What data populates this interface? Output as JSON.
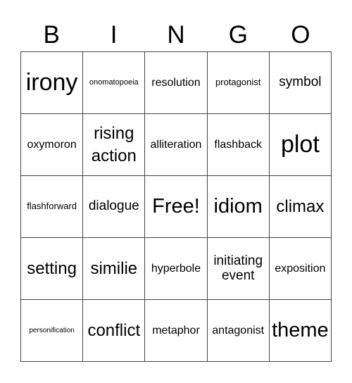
{
  "header": {
    "letters": [
      "B",
      "I",
      "N",
      "G",
      "O"
    ]
  },
  "board": {
    "rows": [
      [
        "irony",
        "onomatopoeia",
        "resolution",
        "protagonist",
        "symbol"
      ],
      [
        "oxymoron",
        "rising action",
        "alliteration",
        "flashback",
        "plot"
      ],
      [
        "flashforward",
        "dialogue",
        "Free!",
        "idiom",
        "climax"
      ],
      [
        "setting",
        "similie",
        "hyperbole",
        "initiating event",
        "exposition"
      ],
      [
        "personification",
        "conflict",
        "metaphor",
        "antagonist",
        "theme"
      ]
    ]
  }
}
